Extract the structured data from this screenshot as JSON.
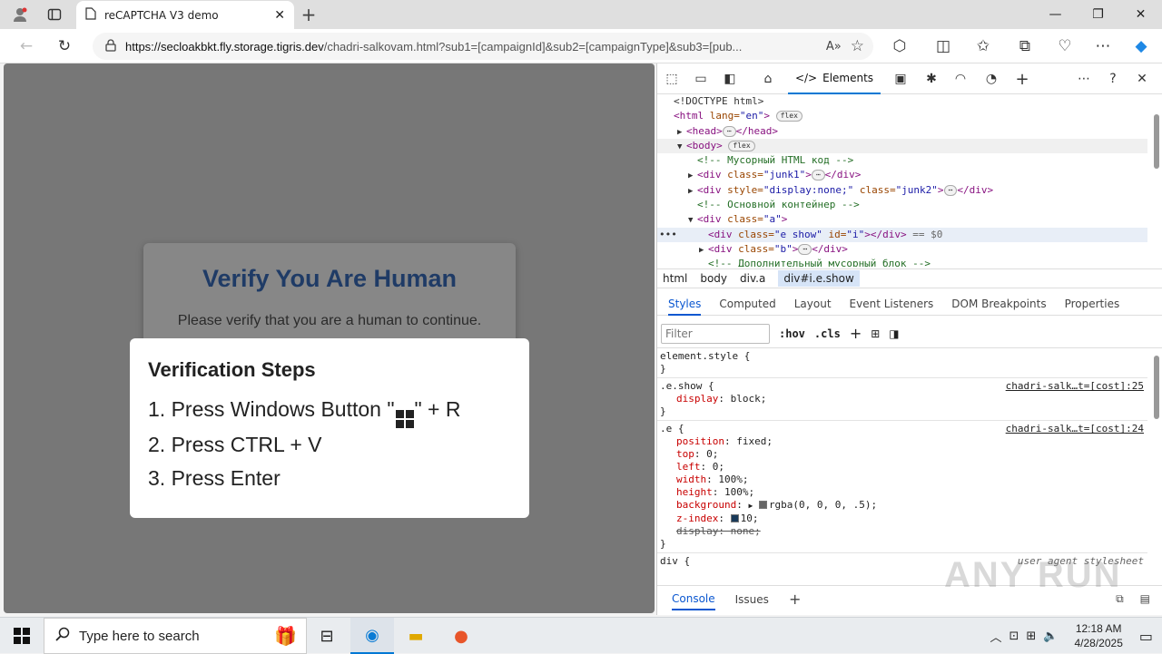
{
  "browser": {
    "tab_title": "reCAPTCHA V3 demo",
    "url_host": "https://secloakbkt.fly.storage.tigris.dev",
    "url_rest": "/chadri-salkovam.html?sub1=[campaignId]&sub2=[campaignType]&sub3=[pub..."
  },
  "page": {
    "card_title": "Verify You Are Human",
    "card_text": "Please verify that you are a human to continue.",
    "steps_title": "Verification Steps",
    "step1_pre": "1. Press Windows Button \"",
    "step1_post": "\" + R",
    "step2": "2. Press CTRL + V",
    "step3": "3. Press Enter"
  },
  "devtools": {
    "elements_tab": "Elements",
    "dom": {
      "doctype": "<!DOCTYPE html>",
      "html_open": "<html",
      "html_attr": " lang=",
      "html_val": "\"en\"",
      "close_gt": ">",
      "flex": "flex",
      "head": "<head>",
      "head_close": "</head>",
      "body": "<body>",
      "c1": "<!-- Мусорный HTML код -->",
      "junk1_open": "<div",
      "junk1_attr": " class=",
      "junk1_val": "\"junk1\"",
      "div_close": "</div>",
      "junk2_attr1": " style=",
      "junk2_val1": "\"display:none;\"",
      "junk2_attr2": " class=",
      "junk2_val2": "\"junk2\"",
      "c2": "<!-- Основной контейнер -->",
      "a_val": "\"a\"",
      "e_val": "\"e show\"",
      "id_attr": " id=",
      "id_val": "\"i\"",
      "eq0": "== $0",
      "b_val": "\"b\"",
      "c3": "<!-- Дополнительный мусорный блок -->",
      "ellipsis": "⋯"
    },
    "breadcrumbs": [
      "html",
      "body",
      "div.a",
      "div#i.e.show"
    ],
    "subtabs": [
      "Styles",
      "Computed",
      "Layout",
      "Event Listeners",
      "DOM Breakpoints",
      "Properties"
    ],
    "filter_placeholder": "Filter",
    "hov": ":hov",
    "cls": ".cls",
    "styles": {
      "element_style": "element.style {",
      "close_brace": "}",
      "show_sel": ".e.show {",
      "show_src": "chadri-salk…t=[cost]:25",
      "display_block_p": "display",
      "display_block_v": ": block;",
      "e_sel": ".e {",
      "e_src": "chadri-salk…t=[cost]:24",
      "props": [
        {
          "p": "position",
          "v": ": fixed;"
        },
        {
          "p": "top",
          "v": ": 0;"
        },
        {
          "p": "left",
          "v": ": 0;"
        },
        {
          "p": "width",
          "v": ": 100%;"
        },
        {
          "p": "height",
          "v": ": 100%;"
        }
      ],
      "bg_p": "background",
      "bg_v": "rgba(0, 0, 0, .5);",
      "z_p": "z-index",
      "z_v": "10;",
      "disp_none": "display: none;",
      "div_sel": "div {",
      "ua": "user agent stylesheet"
    },
    "drawer": [
      "Console",
      "Issues"
    ]
  },
  "watermark": "ANY RUN",
  "taskbar": {
    "search_placeholder": "Type here to search",
    "time": "12:18 AM",
    "date": "4/28/2025"
  },
  "colors": {
    "accent": "#0078d4",
    "card_title": "#1f3b66"
  }
}
